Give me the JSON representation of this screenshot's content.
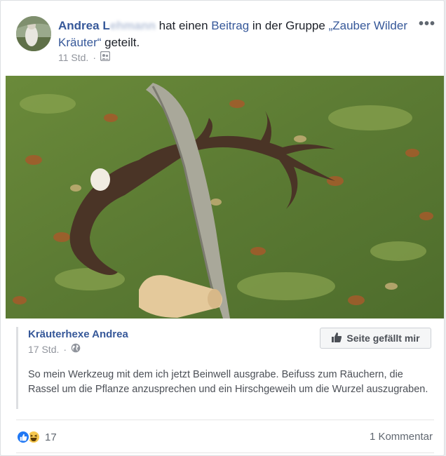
{
  "post": {
    "author_first": "Andrea",
    "author_last": "L",
    "author_last_obscured": "ehmann",
    "action_text": " hat einen ",
    "beitrag_link": "Beitrag",
    "group_text": " in der Gruppe ",
    "group_name": "„Zauber Wilder Kräuter“",
    "shared_suffix": " geteilt.",
    "timestamp": "11 Std.",
    "separator": "·",
    "audience_icon": "group-icon",
    "more_label": "•••"
  },
  "shared_post": {
    "page_name": "Kräuterhexe Andrea",
    "timestamp": "17 Std.",
    "separator": "·",
    "audience_icon": "globe-icon",
    "like_page_label": "Seite gefällt mir",
    "text": "So mein Werkzeug mit dem ich jetzt Beinwell ausgrabe. Beifuss zum Räuchern, die Rassel um die Pflanze anzusprechen und ein Hirschgeweih um die Wurzel auszugraben."
  },
  "footer": {
    "reaction_count": "17",
    "reaction_icons": [
      "like-icon",
      "haha-icon"
    ],
    "comments_label": "1 Kommentar"
  },
  "colors": {
    "link": "#365899",
    "meta": "#90949c",
    "like_blue": "#2078f4",
    "haha_yellow": "#f7c84e"
  }
}
